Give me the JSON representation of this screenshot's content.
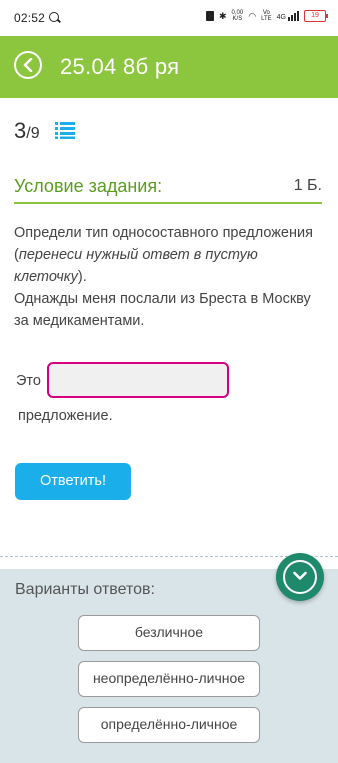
{
  "status_bar": {
    "time": "02:52",
    "speed_top": "0,00",
    "speed_bottom": "K/S",
    "net_top": "Vo",
    "net_bottom": "LTE",
    "lte_label": "4G",
    "battery": "19"
  },
  "header": {
    "title": "25.04 8б ря",
    "color": "#8cc63f"
  },
  "progress": {
    "current": "3",
    "total": "/9"
  },
  "condition": {
    "title": "Условие задания:",
    "points": "1 Б."
  },
  "task": {
    "instruction": "Определи тип односоставного предложения (",
    "instruction_hint": "перенеси нужный ответ в пустую клеточку",
    "instruction_end": ").",
    "sentence": "Однажды меня послали из Бреста в Москву за медикаментами.",
    "prefix": "Это",
    "suffix": "предложение."
  },
  "answer_button": {
    "label": "Ответить!"
  },
  "variants": {
    "title": "Варианты ответов:",
    "options": [
      "безличное",
      "неопределённо-личное",
      "определённо-личное"
    ]
  }
}
